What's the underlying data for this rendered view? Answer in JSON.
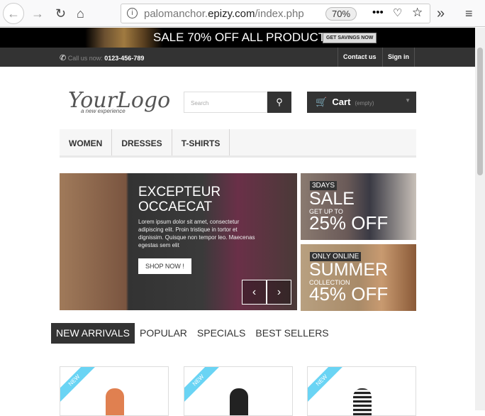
{
  "browser": {
    "url_host": "palomanchor.",
    "url_domain": "epizy.com",
    "url_path": "/index.php",
    "zoom": "70%"
  },
  "promo": {
    "text": "SALE 70% OFF ALL PRODUCTS",
    "button": "GET SAVINGS NOW"
  },
  "nav": {
    "call_label": "Call us now:",
    "phone": "0123-456-789",
    "contact": "Contact us",
    "signin": "Sign in"
  },
  "header": {
    "logo": "YourLogo",
    "tagline": "a new experience",
    "search_placeholder": "Search",
    "cart": "Cart",
    "cart_status": "(empty)"
  },
  "menu": [
    "WOMEN",
    "DRESSES",
    "T-SHIRTS"
  ],
  "slider": {
    "title1": "EXCEPTEUR",
    "title2": "OCCAECAT",
    "text": "Lorem ipsum dolor sit amet, consectetur adipiscing elit. Proin tristique in tortor et dignissim. Quisque non tempor leo. Maecenas egestas sem elit",
    "button": "SHOP NOW !"
  },
  "banners": [
    {
      "tag": "3DAYS",
      "big": "SALE",
      "small": "GET UP TO",
      "pct": "25% OFF"
    },
    {
      "tag": "ONLY ONLINE",
      "big": "SUMMER",
      "small": "COLLECTION",
      "pct": "45% OFF"
    }
  ],
  "tabs": [
    "NEW ARRIVALS",
    "POPULAR",
    "SPECIALS",
    "BEST SELLERS"
  ],
  "product_badge": "NEW"
}
